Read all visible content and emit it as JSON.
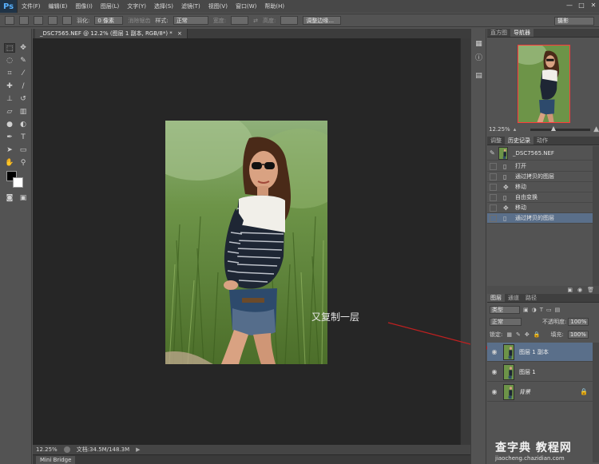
{
  "app": {
    "logo": "Ps"
  },
  "menu": [
    "文件(F)",
    "编辑(E)",
    "图像(I)",
    "图层(L)",
    "文字(Y)",
    "选择(S)",
    "滤镜(T)",
    "视图(V)",
    "窗口(W)",
    "帮助(H)"
  ],
  "window_controls": [
    "—",
    "□",
    "✕"
  ],
  "options": {
    "feather_label": "羽化:",
    "feather_value": "0 像素",
    "antialias_label": "消除锯齿",
    "style_label": "样式:",
    "style_value": "正常",
    "width_label": "宽度:",
    "height_label": "高度:",
    "refine_edge": "调整边缘...",
    "workspace": "摄影"
  },
  "document": {
    "tab_title": "_DSC7565.NEF @ 12.2% (图层 1 副本, RGB/8*) *",
    "tab_close": "×",
    "zoom": "12.25%",
    "doc_size": "文档:34.5M/148.3M",
    "minibridge": "Mini Bridge"
  },
  "annotation": {
    "text": "又复制一层"
  },
  "navigator": {
    "tabs": [
      "直方图",
      "导航器"
    ],
    "zoom": "12.25%"
  },
  "history": {
    "tabs": [
      "调整",
      "历史记录",
      "动作"
    ],
    "snapshot": "_DSC7565.NEF",
    "items": [
      "打开",
      "通过拷贝的图层",
      "移动",
      "自由变换",
      "移动",
      "通过拷贝的图层"
    ],
    "selected_index": 5
  },
  "layers": {
    "tabs": [
      "图层",
      "通道",
      "路径"
    ],
    "filter": "类型",
    "blend_mode": "正常",
    "opacity_label": "不透明度:",
    "opacity_value": "100%",
    "lock_label": "锁定:",
    "fill_label": "填充:",
    "fill_value": "100%",
    "items": [
      "图层 1 副本",
      "图层 1",
      "背景"
    ],
    "selected_index": 0
  },
  "watermark": {
    "title": "查字典 教程网",
    "subtitle": "jiaocheng.chazidian.com"
  },
  "colors": {
    "canvas_bg": "#262626",
    "panel_bg": "#535353",
    "selection": "#5a6f8a",
    "arrow": "#c02020"
  }
}
